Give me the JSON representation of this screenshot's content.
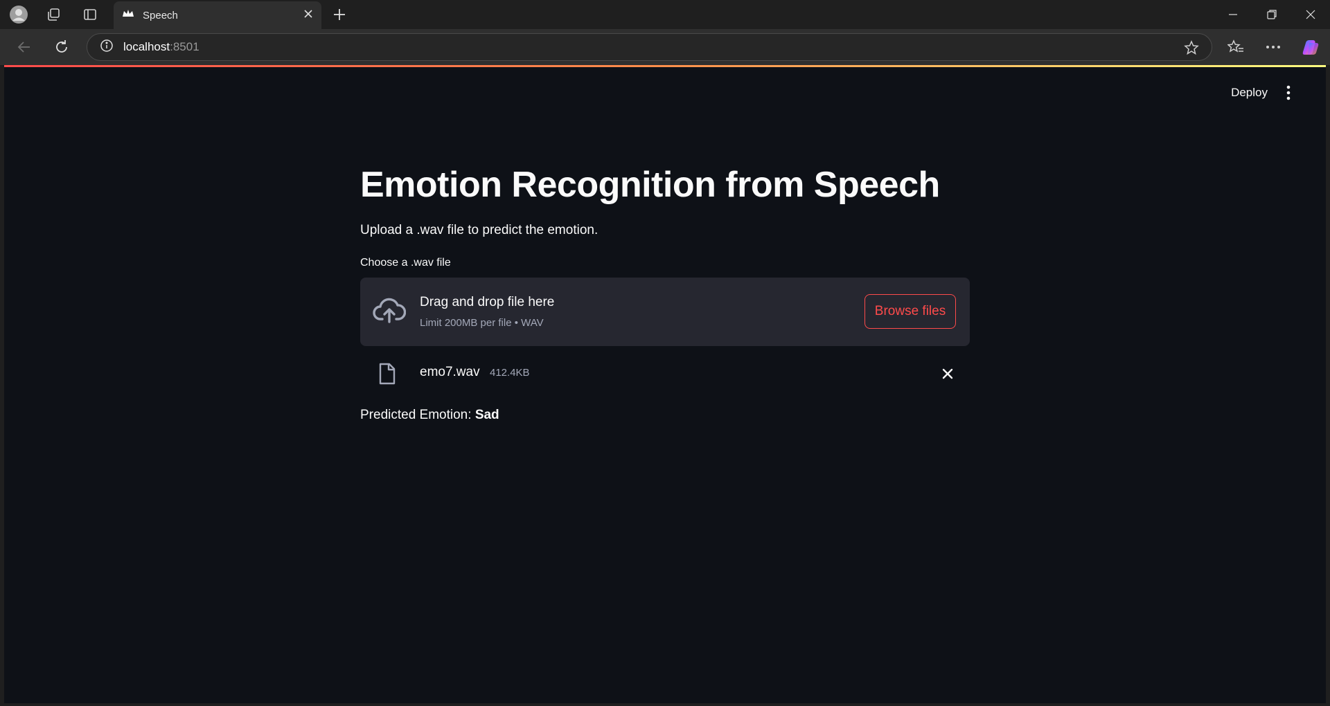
{
  "browser": {
    "tab": {
      "title": "Speech",
      "favicon": "streamlit-crown-icon"
    },
    "url": {
      "host": "localhost",
      "port": ":8501"
    },
    "icons": [
      "profile-icon",
      "workspaces-icon",
      "tab-actions-icon",
      "close-tab-icon",
      "new-tab-icon",
      "minimize-icon",
      "restore-icon",
      "close-window-icon",
      "back-icon",
      "refresh-icon",
      "site-info-icon",
      "favorite-star-icon",
      "favorites-icon",
      "more-icon",
      "copilot-icon"
    ]
  },
  "header": {
    "deploy_label": "Deploy",
    "menu_icon": "kebab-menu-icon"
  },
  "main": {
    "title": "Emotion Recognition from Speech",
    "subtitle": "Upload a .wav file to predict the emotion.",
    "uploader": {
      "label": "Choose a .wav file",
      "drop_text": "Drag and drop file here",
      "limit_text": "Limit 200MB per file • WAV",
      "browse_label": "Browse files",
      "icon": "cloud-upload-icon"
    },
    "uploaded_file": {
      "name": "emo7.wav",
      "size": "412.4KB",
      "icon": "file-icon",
      "remove_icon": "close-icon"
    },
    "prediction": {
      "label": "Predicted Emotion:",
      "value": "Sad"
    }
  },
  "colors": {
    "app_background": "#0e1117",
    "dropzone_background": "#262730",
    "accent": "#ff4b4b",
    "text": "#fafafa",
    "muted_text": "#a3a8b8"
  }
}
